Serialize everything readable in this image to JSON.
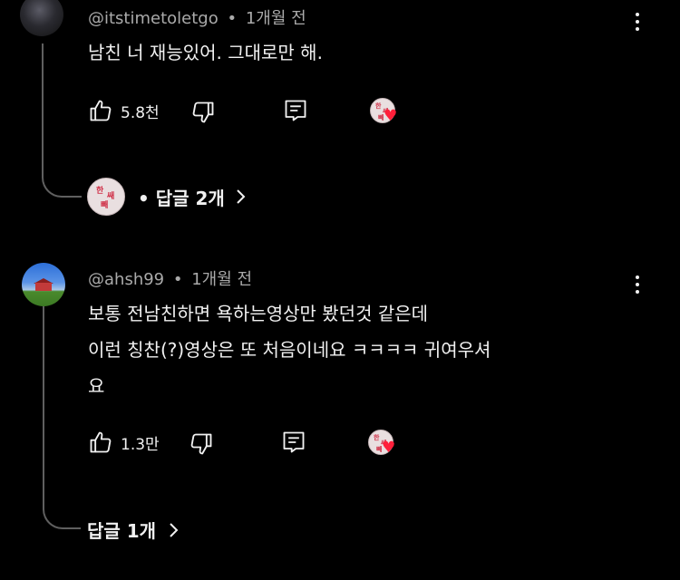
{
  "comments": [
    {
      "handle": "@itstimetoletgo",
      "separator": "•",
      "time": "1개월 전",
      "lines": [
        "남친 너 재능있어. 그대로만 해."
      ],
      "likes": "5.8천",
      "replies_label": "• 답글 2개",
      "avatar_icon": "dark-profile-photo",
      "heart_avatar_text": [
        "한",
        "쌔",
        "빼"
      ]
    },
    {
      "handle": "@ahsh99",
      "separator": "•",
      "time": "1개월 전",
      "lines": [
        "보통 전남친하면 욕하는영상만 봤던것 같은데",
        "이런 칭찬(?)영상은 또 처음이네요 ㅋㅋㅋㅋ 귀여우셔",
        "요"
      ],
      "likes": "1.3만",
      "replies_label": "답글 1개",
      "avatar_icon": "landscape-house-photo",
      "heart_avatar_text": [
        "한",
        "쌔",
        "빼"
      ]
    }
  ],
  "icons": {
    "like": "thumbs-up-icon",
    "dislike": "thumbs-down-icon",
    "reply": "comment-icon",
    "more": "kebab-menu-icon",
    "chevron": "chevron-right-icon",
    "heart": "creator-heart-icon"
  },
  "colors": {
    "background": "#000000",
    "text": "#f1f1f1",
    "muted": "#aaaaaa",
    "heart": "#ff1f3a",
    "thread": "#5f5f5f"
  }
}
